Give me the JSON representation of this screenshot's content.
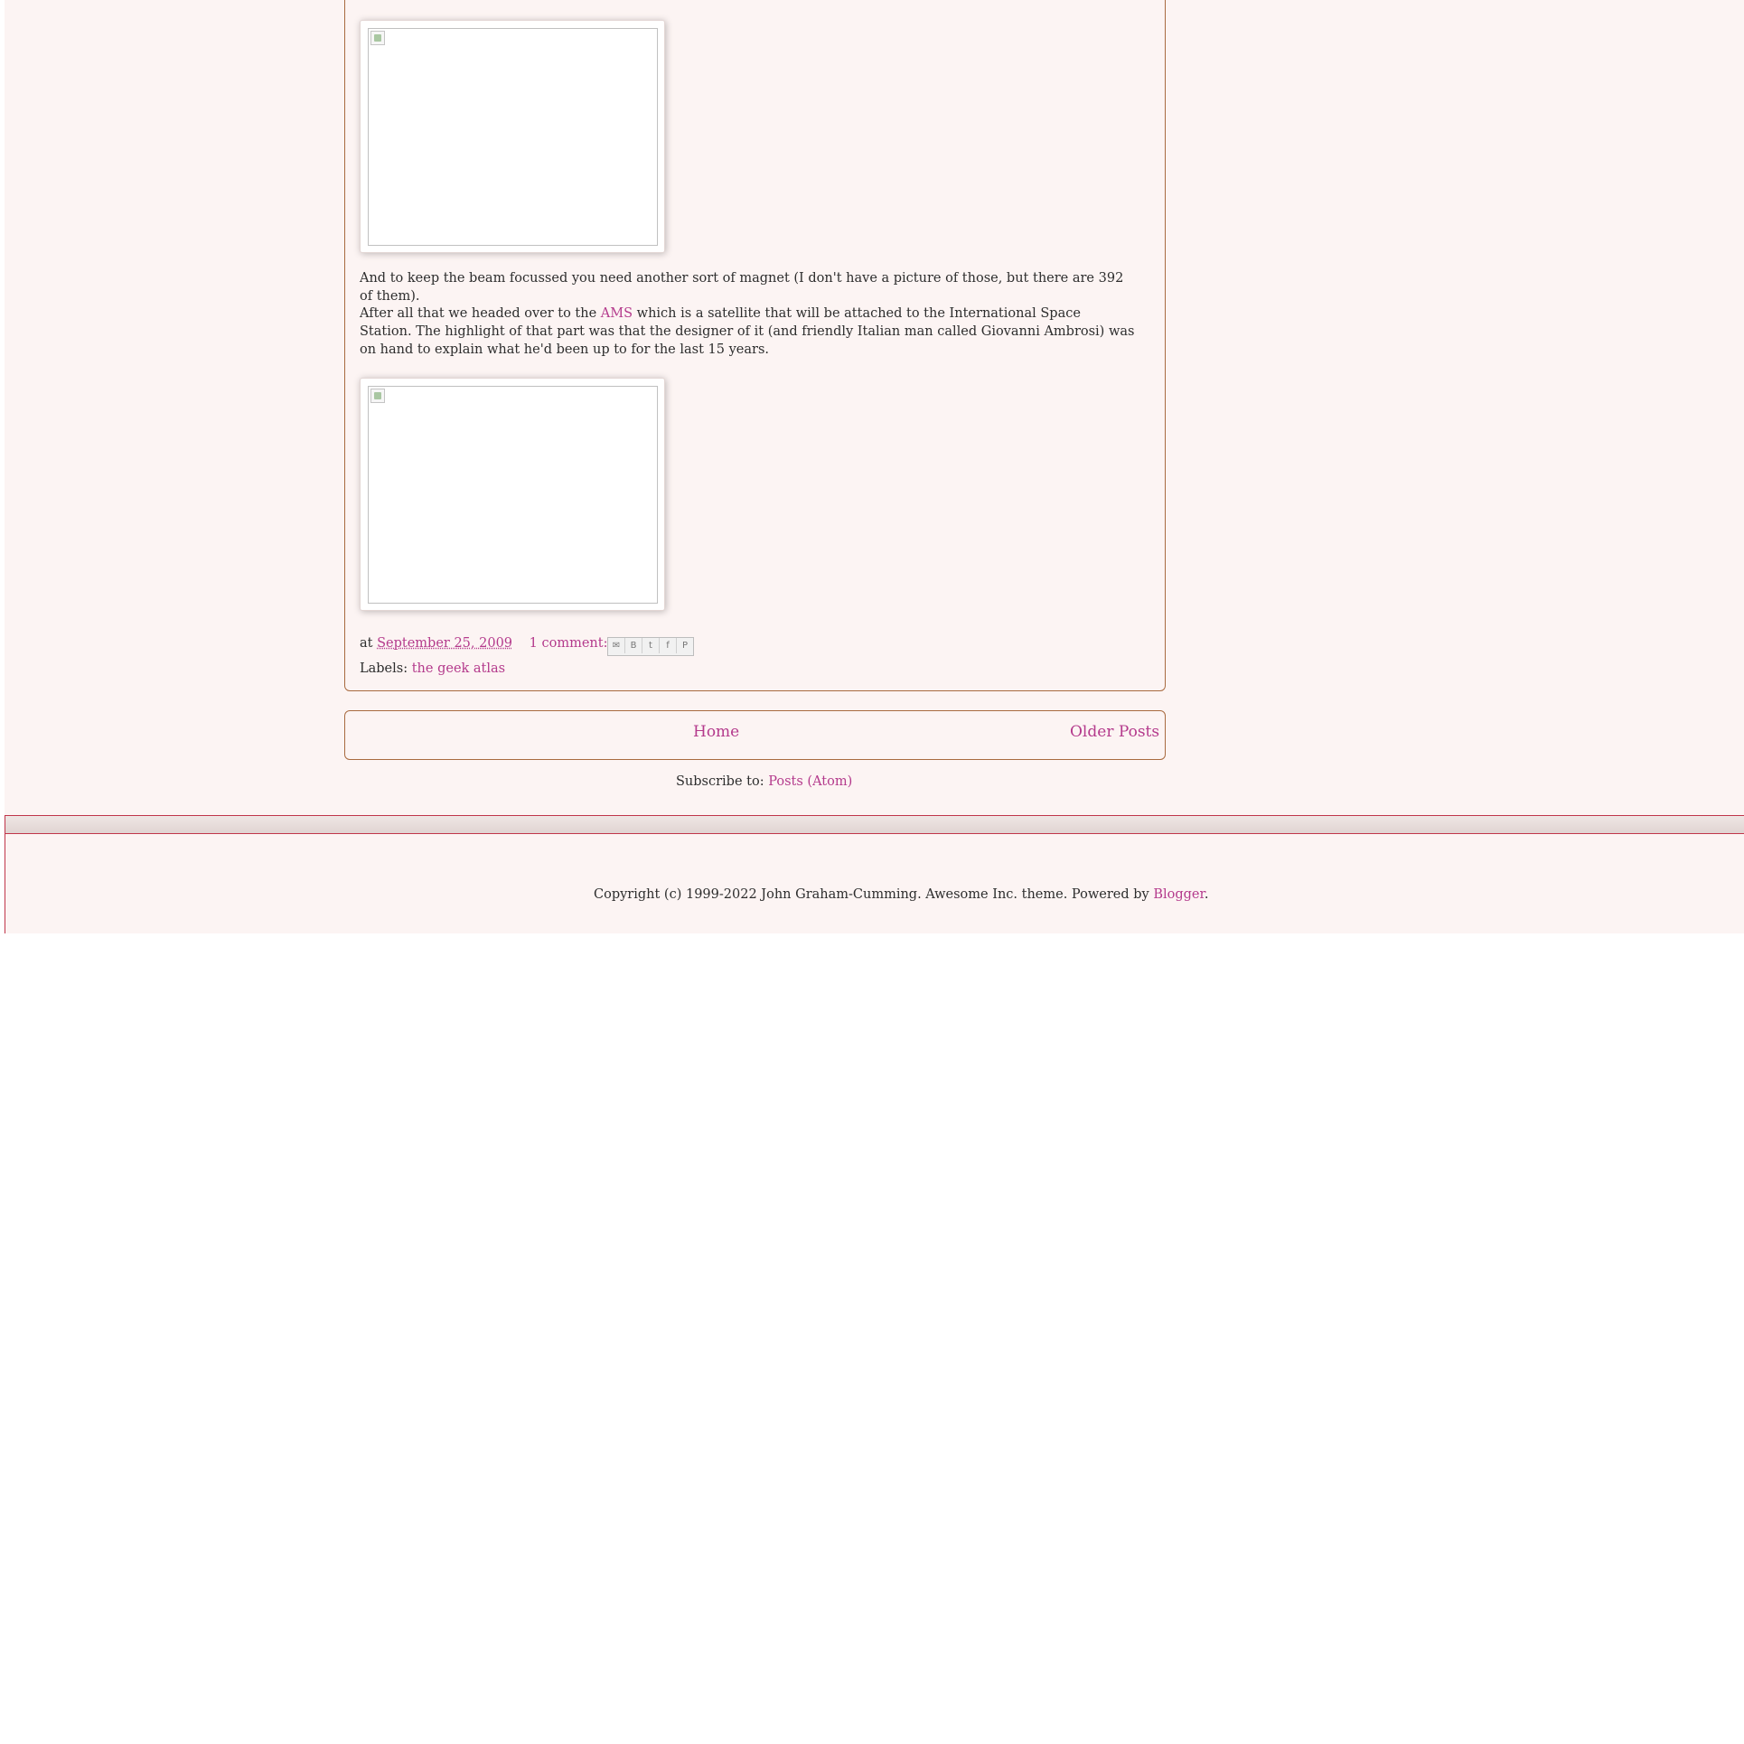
{
  "post": {
    "paragraph_1": "And to keep the beam focussed you need another sort of magnet (I don't have a picture of those, but there are 392 of them).",
    "paragraph_2_before_link": "After all that we headed over to the ",
    "paragraph_2_link": "AMS",
    "paragraph_2_after_link": " which is a satellite that will be attached to the International Space Station. The highlight of that part was that the designer of it (and friendly Italian man called Giovanni Ambrosi) was on hand to explain what he'd been up to for the last 15 years.",
    "footer": {
      "at_label": "at",
      "date": "September 25, 2009",
      "comments": "1 comment:",
      "labels_label": "Labels:",
      "label_link": "the geek atlas"
    },
    "share_icons": [
      "email-icon",
      "blogthis-icon",
      "twitter-icon",
      "facebook-icon",
      "pinterest-icon"
    ]
  },
  "nav": {
    "home": "Home",
    "older_posts": "Older Posts"
  },
  "subscribe": {
    "label": "Subscribe to:",
    "link": "Posts (Atom)"
  },
  "copyright": {
    "text": "Copyright (c) 1999-2022 John Graham-Cumming. Awesome Inc. theme. Powered by ",
    "link": "Blogger",
    "end": "."
  },
  "colors": {
    "background": "#fcf4f3",
    "link": "#b43a8c",
    "border": "#a86a3f",
    "footer_border": "#c0354a"
  }
}
